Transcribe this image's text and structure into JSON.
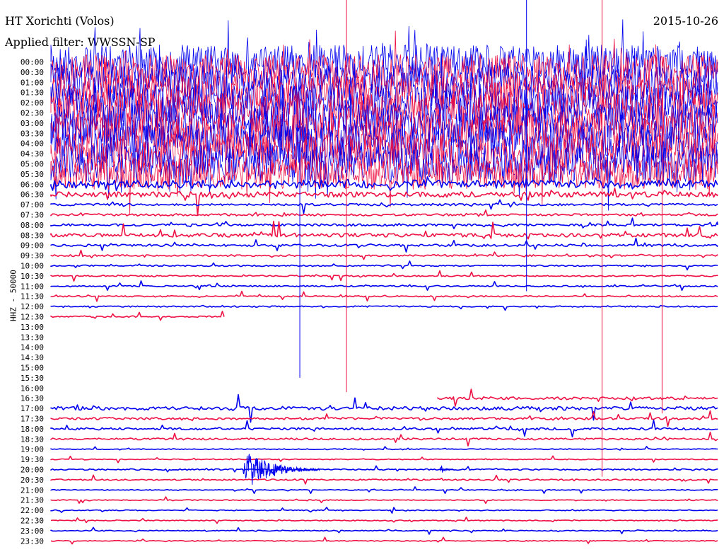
{
  "header": {
    "station": "HT Xorichti (Volos)",
    "filter_label": "Applied filter: WWSSN-SP",
    "date": "2015-10-26",
    "channel_label": "HHZ - 50000"
  },
  "colors": {
    "odd_row": "#0000ee",
    "even_row": "#ee1144",
    "text": "#000000"
  },
  "chart_data": {
    "type": "line",
    "title": "HT Xorichti (Volos)",
    "subtitle": "Applied filter: WWSSN-SP",
    "date": "2015-10-26",
    "ylabel": "HHZ - 50000",
    "xlabel": "",
    "row_labels": [
      "00:00",
      "00:30",
      "01:00",
      "01:30",
      "02:00",
      "02:30",
      "03:00",
      "03:30",
      "04:00",
      "04:30",
      "05:00",
      "05:30",
      "06:00",
      "06:30",
      "07:00",
      "07:30",
      "08:00",
      "08:30",
      "09:00",
      "09:30",
      "10:00",
      "10:30",
      "11:00",
      "11:30",
      "12:00",
      "12:30",
      "13:00",
      "13:30",
      "14:00",
      "14:30",
      "15:00",
      "15:30",
      "16:00",
      "16:30",
      "17:00",
      "17:30",
      "18:00",
      "18:30",
      "19:00",
      "19:30",
      "20:00",
      "20:30",
      "21:00",
      "21:30",
      "22:00",
      "22:30",
      "23:00",
      "23:30"
    ],
    "row_duration_min": 30,
    "series_colors": [
      "blue",
      "red"
    ],
    "noise_level": [
      0.75,
      0.78,
      0.8,
      0.82,
      0.85,
      0.87,
      0.88,
      0.9,
      0.9,
      0.9,
      0.85,
      0.7,
      0.18,
      0.12,
      0.05,
      0.05,
      0.05,
      0.08,
      0.05,
      0.04,
      0.03,
      0.03,
      0.03,
      0.03,
      0.03,
      0.03,
      0.0,
      0.0,
      0.0,
      0.0,
      0.0,
      0.0,
      0.0,
      0.06,
      0.08,
      0.05,
      0.05,
      0.04,
      0.02,
      0.02,
      0.03,
      0.03,
      0.02,
      0.02,
      0.02,
      0.02,
      0.02,
      0.02
    ],
    "row_start_fraction": [
      0,
      0,
      0,
      0,
      0,
      0,
      0,
      0,
      0,
      0,
      0,
      0,
      0,
      0,
      0,
      0,
      0,
      0,
      0,
      0,
      0,
      0,
      0,
      0,
      0,
      0,
      0,
      0,
      0,
      0,
      0,
      0,
      0,
      0.58,
      0,
      0,
      0,
      0,
      0,
      0,
      0,
      0,
      0,
      0,
      0,
      0,
      0,
      0
    ],
    "row_end_fraction": [
      1,
      1,
      1,
      1,
      1,
      1,
      1,
      1,
      1,
      1,
      1,
      1,
      1,
      1,
      1,
      1,
      1,
      1,
      1,
      1,
      1,
      1,
      1,
      1,
      1,
      0.26,
      0,
      0,
      0,
      0,
      0,
      0,
      0,
      1,
      1,
      1,
      1,
      1,
      1,
      1,
      1,
      1,
      1,
      1,
      1,
      1,
      1,
      1
    ],
    "events": [
      {
        "time": "20:00",
        "row": "20:00",
        "minute_in_row": 8.6,
        "amplitude_rows": 1.8,
        "duration_min": 3.5,
        "note": ""
      },
      {
        "time": "20:00",
        "row": "20:00",
        "minute_in_row": 17.5,
        "amplitude_rows": 0.5,
        "duration_min": 0.6,
        "note": ""
      }
    ],
    "spikes": [
      {
        "row": "00:00",
        "minute_in_row": 13.3,
        "up_rows": 6.2,
        "down_rows": 32.4
      },
      {
        "row": "00:00",
        "minute_in_row": 21.4,
        "up_rows": 6.2,
        "down_rows": 22.5
      },
      {
        "row": "00:00",
        "minute_in_row": 24.8,
        "up_rows": 6.2,
        "down_rows": 40.7
      },
      {
        "row": "00:00",
        "minute_in_row": 11.2,
        "up_rows": 0.2,
        "down_rows": 31.0
      },
      {
        "row": "00:00",
        "minute_in_row": 27.5,
        "up_rows": 0.5,
        "down_rows": 34.5
      }
    ]
  }
}
